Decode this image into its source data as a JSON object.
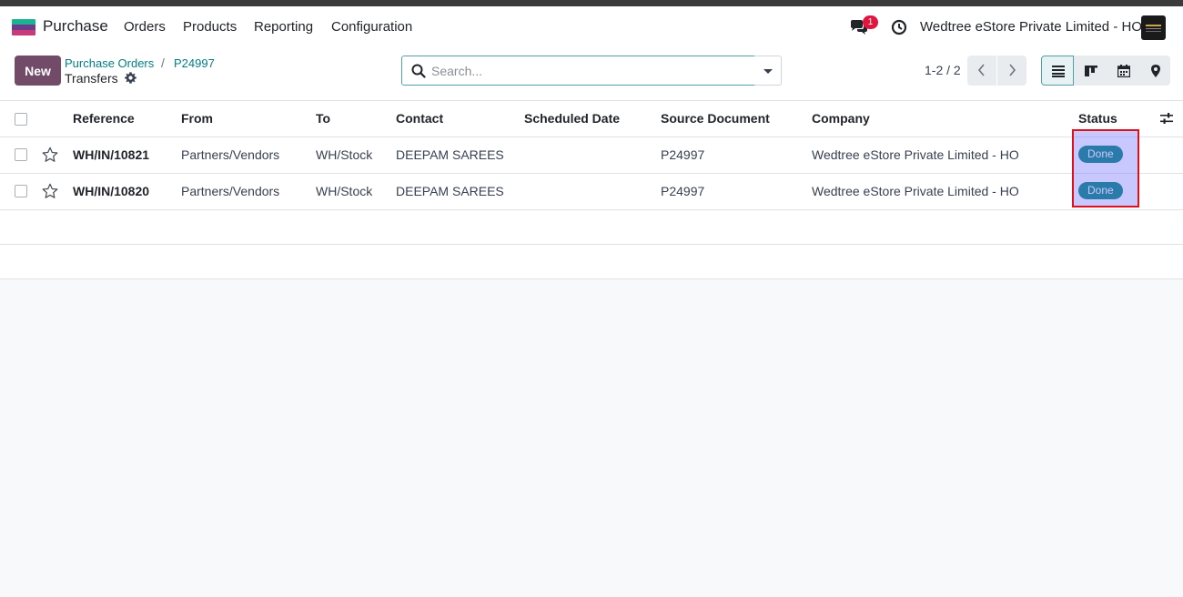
{
  "navbar": {
    "app_name": "Purchase",
    "menus": [
      "Orders",
      "Products",
      "Reporting",
      "Configuration"
    ],
    "chat_badge": "1",
    "company": "Wedtree eStore Private Limited - HO"
  },
  "controlbar": {
    "new_label": "New",
    "breadcrumb": [
      "Purchase Orders",
      "P24997"
    ],
    "breadcrumb_sep": "/",
    "current": "Transfers",
    "search_placeholder": "Search...",
    "pager": "1-2 / 2",
    "views": [
      "list-icon",
      "kanban-icon",
      "calendar-icon",
      "map-icon"
    ]
  },
  "table": {
    "columns": [
      "Reference",
      "From",
      "To",
      "Contact",
      "Scheduled Date",
      "Source Document",
      "Company",
      "Status"
    ],
    "rows": [
      {
        "reference": "WH/IN/10821",
        "from": "Partners/Vendors",
        "to": "WH/Stock",
        "contact": "DEEPAM SAREES",
        "scheduled": "",
        "source": "P24997",
        "company": "Wedtree eStore Private Limited - HO",
        "status": "Done"
      },
      {
        "reference": "WH/IN/10820",
        "from": "Partners/Vendors",
        "to": "WH/Stock",
        "contact": "DEEPAM SAREES",
        "scheduled": "",
        "source": "P24997",
        "company": "Wedtree eStore Private Limited - HO",
        "status": "Done"
      }
    ]
  },
  "colors": {
    "brand": "#714b67",
    "link": "#017e84",
    "status_done": "#008474",
    "highlight_border": "#e0101a"
  }
}
